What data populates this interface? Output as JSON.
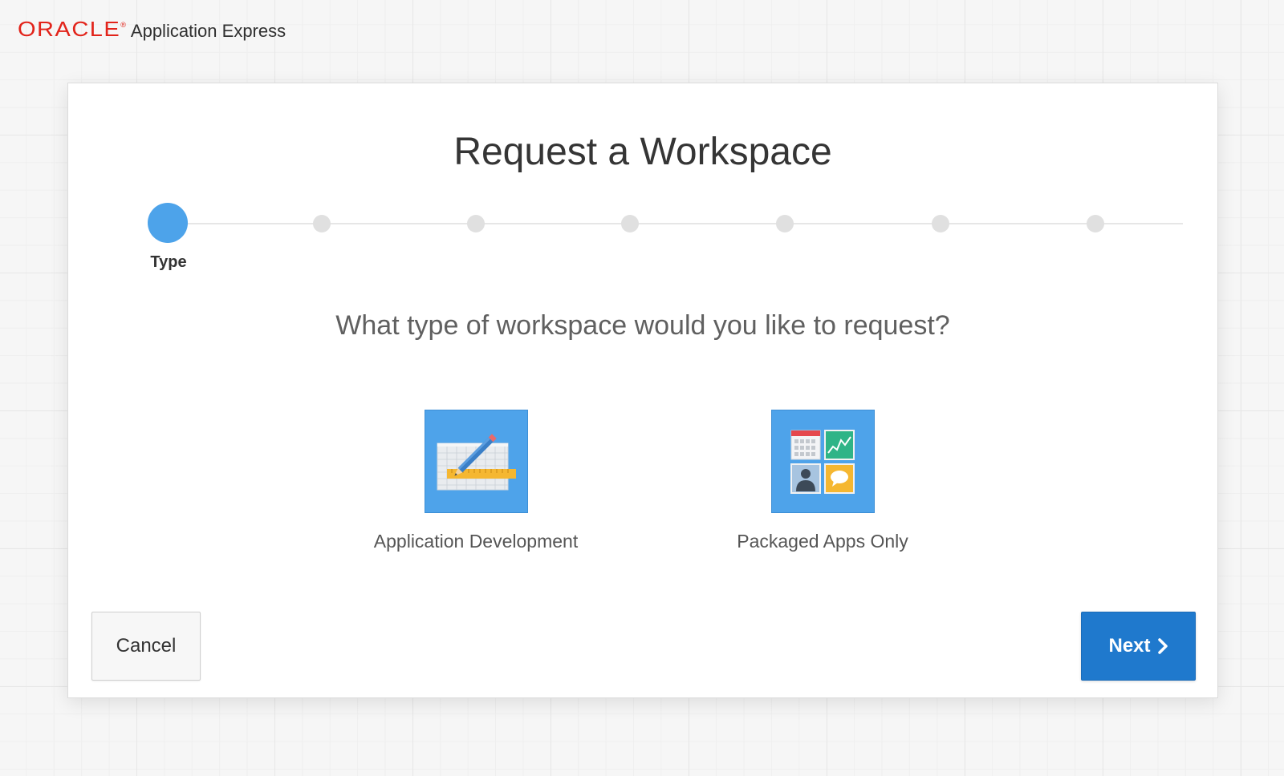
{
  "header": {
    "brand": "ORACLE",
    "brand_mark": "®",
    "product": "Application Express"
  },
  "dialog": {
    "title": "Request a Workspace",
    "wizard": {
      "total_steps": 7,
      "current_step": 1,
      "current_label": "Type"
    },
    "question": "What type of workspace would you like to request?",
    "options": [
      {
        "label": "Application Development",
        "icon": "pencil-ruler-grid-icon"
      },
      {
        "label": "Packaged Apps Only",
        "icon": "app-tiles-icon"
      }
    ]
  },
  "buttons": {
    "cancel_label": "Cancel",
    "next_label": "Next",
    "next_icon": "chevron-right-icon"
  },
  "colors": {
    "brand_red": "#e2231a",
    "accent_blue": "#4da3ea",
    "primary_button": "#1f79cd"
  }
}
